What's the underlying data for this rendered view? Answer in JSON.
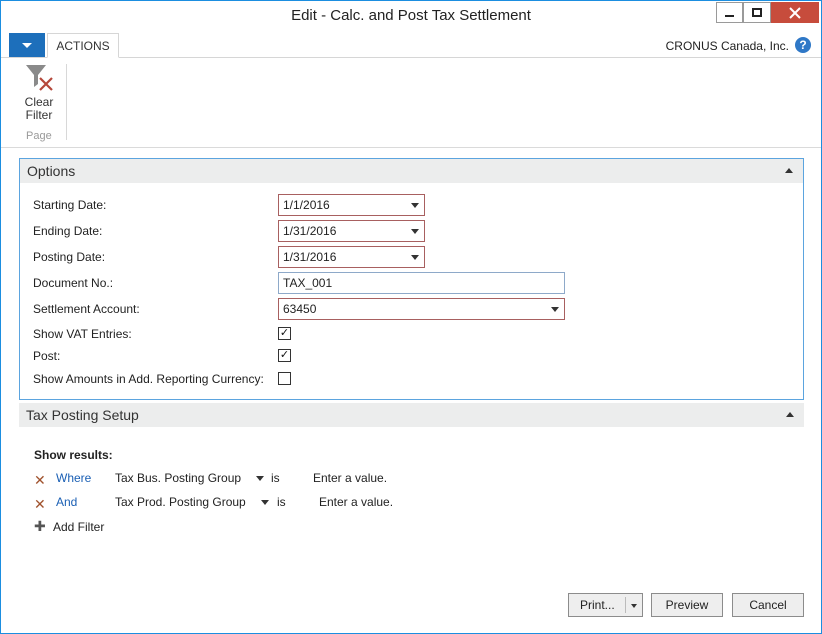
{
  "window": {
    "title": "Edit - Calc. and Post Tax Settlement"
  },
  "ribbon": {
    "tab_actions": "ACTIONS",
    "company": "CRONUS Canada, Inc.",
    "clear_filter_line1": "Clear",
    "clear_filter_line2": "Filter",
    "group_label": "Page"
  },
  "options": {
    "header": "Options",
    "fields": {
      "starting_date_label": "Starting Date:",
      "starting_date_value": "1/1/2016",
      "ending_date_label": "Ending Date:",
      "ending_date_value": "1/31/2016",
      "posting_date_label": "Posting Date:",
      "posting_date_value": "1/31/2016",
      "document_no_label": "Document No.:",
      "document_no_value": "TAX_001",
      "settlement_account_label": "Settlement Account:",
      "settlement_account_value": "63450",
      "show_vat_label": "Show VAT Entries:",
      "post_label": "Post:",
      "show_amounts_label": "Show Amounts in Add. Reporting Currency:"
    },
    "checks": {
      "show_vat_entries": true,
      "post": true,
      "show_amounts_add_currency": false
    }
  },
  "tax_posting_setup": {
    "header": "Tax Posting Setup",
    "show_results": "Show results:",
    "filters": [
      {
        "keyword": "Where",
        "field": "Tax Bus. Posting Group",
        "operator": "is",
        "value": "Enter a value."
      },
      {
        "keyword": "And",
        "field": "Tax Prod. Posting Group",
        "operator": "is",
        "value": "Enter a value."
      }
    ],
    "add_filter": "Add Filter"
  },
  "buttons": {
    "print": "Print...",
    "preview": "Preview",
    "cancel": "Cancel"
  }
}
